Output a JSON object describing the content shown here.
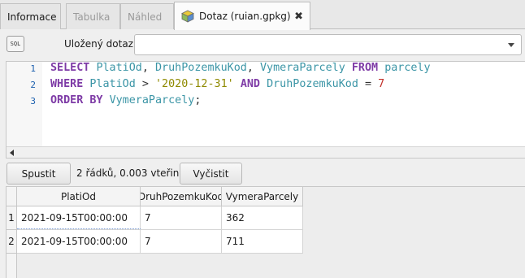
{
  "tabs": [
    {
      "label": "Informace",
      "state": "normal"
    },
    {
      "label": "Tabulka",
      "state": "disabled"
    },
    {
      "label": "Náhled",
      "state": "disabled"
    },
    {
      "label": "Dotaz (ruian.gpkg)",
      "state": "active",
      "icon": "database-icon",
      "close_label": "✖"
    }
  ],
  "toolbar": {
    "sql_icon_text": "SQL",
    "saved_query_label": "Uložený dotaz",
    "saved_query_value": ""
  },
  "editor": {
    "line_numbers": [
      "1",
      "2",
      "3"
    ],
    "lines": [
      [
        {
          "t": "SELECT",
          "c": "kw"
        },
        {
          "t": " ",
          "c": "plain"
        },
        {
          "t": "PlatiOd",
          "c": "id"
        },
        {
          "t": ", ",
          "c": "plain"
        },
        {
          "t": "DruhPozemkuKod",
          "c": "id"
        },
        {
          "t": ", ",
          "c": "plain"
        },
        {
          "t": "VymeraParcely",
          "c": "id"
        },
        {
          "t": " ",
          "c": "plain"
        },
        {
          "t": "FROM",
          "c": "kw"
        },
        {
          "t": " ",
          "c": "plain"
        },
        {
          "t": "parcely",
          "c": "id"
        }
      ],
      [
        {
          "t": "WHERE",
          "c": "kw"
        },
        {
          "t": " ",
          "c": "plain"
        },
        {
          "t": "PlatiOd",
          "c": "id"
        },
        {
          "t": " > ",
          "c": "plain"
        },
        {
          "t": "'2020-12-31'",
          "c": "str"
        },
        {
          "t": " ",
          "c": "plain"
        },
        {
          "t": "AND",
          "c": "kw"
        },
        {
          "t": " ",
          "c": "plain"
        },
        {
          "t": "DruhPozemkuKod",
          "c": "id"
        },
        {
          "t": " = ",
          "c": "plain"
        },
        {
          "t": "7",
          "c": "num"
        }
      ],
      [
        {
          "t": "ORDER BY",
          "c": "kw"
        },
        {
          "t": " ",
          "c": "plain"
        },
        {
          "t": "VymeraParcely",
          "c": "id"
        },
        {
          "t": ";",
          "c": "plain"
        }
      ]
    ]
  },
  "actions": {
    "run_label": "Spustit",
    "status_text": "2 řádků, 0.003 vteřin",
    "clear_label": "Vyčistit"
  },
  "results": {
    "columns": [
      "PlatiOd",
      "DruhPozemkuKod",
      "VymeraParcely"
    ],
    "rows": [
      {
        "num": "1",
        "cells": [
          "2021-09-15T00:00:00",
          "7",
          "362"
        ]
      },
      {
        "num": "2",
        "cells": [
          "2021-09-15T00:00:00",
          "7",
          "711"
        ]
      }
    ]
  },
  "colors": {
    "keyword": "#7e3ba6",
    "identifier": "#3b95a6",
    "string": "#8f8a00",
    "number": "#c2302a",
    "line_number": "#1b5fae"
  }
}
